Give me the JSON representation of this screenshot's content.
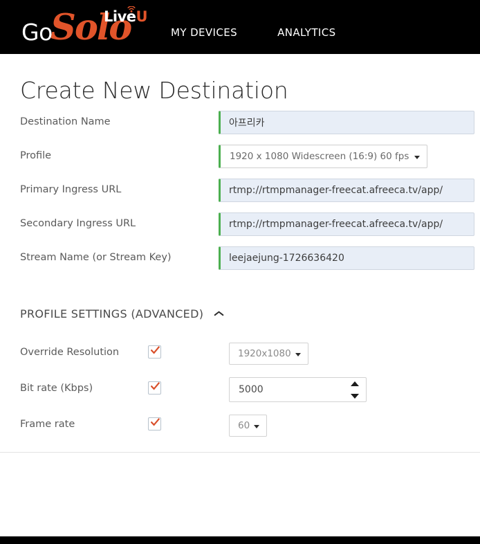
{
  "header": {
    "logo": {
      "go_text": "Go",
      "solo_text": "Solo",
      "live_text": "Live",
      "u_text": "U",
      "antenna_icon": "wifi-antenna-icon"
    },
    "nav": [
      {
        "label": "MY DEVICES",
        "name": "nav-item-my-devices"
      },
      {
        "label": "ANALYTICS",
        "name": "nav-item-analytics"
      }
    ],
    "background_color": "#000000",
    "accent_color": "#e1542a"
  },
  "page": {
    "title": "Create New Destination"
  },
  "form": {
    "fields": [
      {
        "label": "Destination Name",
        "value": "아프리카",
        "type": "text"
      },
      {
        "label": "Profile",
        "value": "1920 x 1080 Widescreen (16:9) 60 fps",
        "type": "select"
      },
      {
        "label": "Primary Ingress URL",
        "value": "rtmp://rtmpmanager-freecat.afreeca.tv/app/",
        "type": "text"
      },
      {
        "label": "Secondary Ingress URL",
        "value": "rtmp://rtmpmanager-freecat.afreeca.tv/app/",
        "type": "text"
      },
      {
        "label": "Stream Name (or Stream Key)",
        "value": "leejaejung-1726636420",
        "type": "text"
      }
    ],
    "input_valid_border_color": "#4caf50",
    "input_background_color": "#e8eef7"
  },
  "advanced": {
    "heading": "PROFILE SETTINGS (ADVANCED)",
    "chevron_icon": "chevron-up-icon",
    "expanded": true,
    "rows": [
      {
        "label": "Override Resolution",
        "checked": true,
        "control_type": "select",
        "control_value": "1920x1080"
      },
      {
        "label": "Bit rate (Kbps)",
        "checked": true,
        "control_type": "spinner",
        "control_value": "5000"
      },
      {
        "label": "Frame rate",
        "checked": true,
        "control_type": "select",
        "control_value": "60"
      }
    ],
    "checkmark_color": "#d9502b"
  }
}
